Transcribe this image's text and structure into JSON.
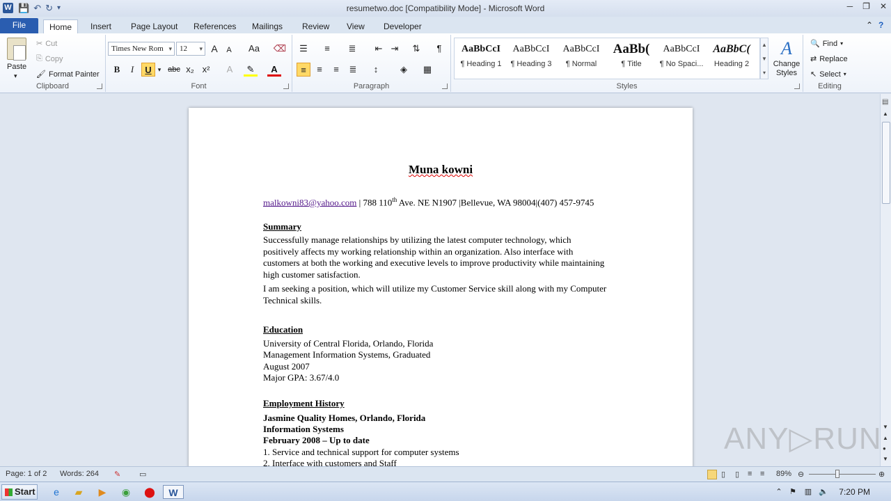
{
  "window": {
    "title": "resumetwo.doc [Compatibility Mode]  -  Microsoft Word",
    "logo": "W"
  },
  "tabs": [
    "File",
    "Home",
    "Insert",
    "Page Layout",
    "References",
    "Mailings",
    "Review",
    "View",
    "Developer"
  ],
  "ribbon": {
    "clipboard": {
      "paste": "Paste",
      "cut": "Cut",
      "copy": "Copy",
      "format_painter": "Format Painter",
      "label": "Clipboard"
    },
    "font": {
      "name": "Times New Rom",
      "size": "12",
      "label": "Font",
      "bold": "B",
      "italic": "I",
      "underline": "U",
      "strike": "abc",
      "sub": "x₂",
      "sup": "x²",
      "grow": "A",
      "shrink": "A",
      "case": "Aa",
      "font_color": "A"
    },
    "paragraph": {
      "label": "Paragraph",
      "pilcrow": "¶"
    },
    "styles": {
      "label": "Styles",
      "items": [
        {
          "sample": "AaBbCcI",
          "name": "¶ Heading 1"
        },
        {
          "sample": "AaBbCcI",
          "name": "¶ Heading 3"
        },
        {
          "sample": "AaBbCcI",
          "name": "¶ Normal"
        },
        {
          "sample": "AaBb(",
          "name": "¶ Title"
        },
        {
          "sample": "AaBbCcI",
          "name": "¶ No Spaci..."
        },
        {
          "sample": "AaBbC(",
          "name": "Heading 2"
        }
      ],
      "change_styles": "Change Styles"
    },
    "editing": {
      "label": "Editing",
      "find": "Find",
      "replace": "Replace",
      "select": "Select"
    }
  },
  "document": {
    "name": "Muna kowni",
    "email": "malkowni83@yahoo.com",
    "contact_rest": " | 788 110",
    "contact_sup": "th",
    "contact_rest2": " Ave.  NE N1907 |Bellevue,  WA  98004|(407) 457-9745",
    "summary_heading": "Summary",
    "summary_p1": "Successfully manage relationships  by utilizing  the latest computer technology, which positively  affects my working relationship  within an organization.  Also interface with customers at both the working and executive levels to improve productivity while maintaining  high  customer satisfaction.",
    "summary_p2": " I am seeking a position,  which will  utilize  my Customer Service skill along with my Computer Technical skills.",
    "education_heading": "Education",
    "education_lines": [
      "University  of Central Florida,  Orlando, Florida",
      "Management  Information Systems, Graduated",
      "August 2007",
      "Major  GPA:   3.67/4.0"
    ],
    "employment_heading": "Employment History",
    "employment_bold": [
      "Jasmine Quality Homes, Orlando, Florida",
      "Information Systems",
      "February  2008 – Up  to date"
    ],
    "employment_items": [
      "1. Service and technical  support for computer systems",
      "2. Interface with customers and Staff"
    ]
  },
  "status": {
    "page": "Page: 1 of 2",
    "words": "Words: 264",
    "zoom": "89%"
  },
  "taskbar": {
    "start": "Start",
    "time": "7:20 PM"
  },
  "watermark": "ANY▷RUN"
}
